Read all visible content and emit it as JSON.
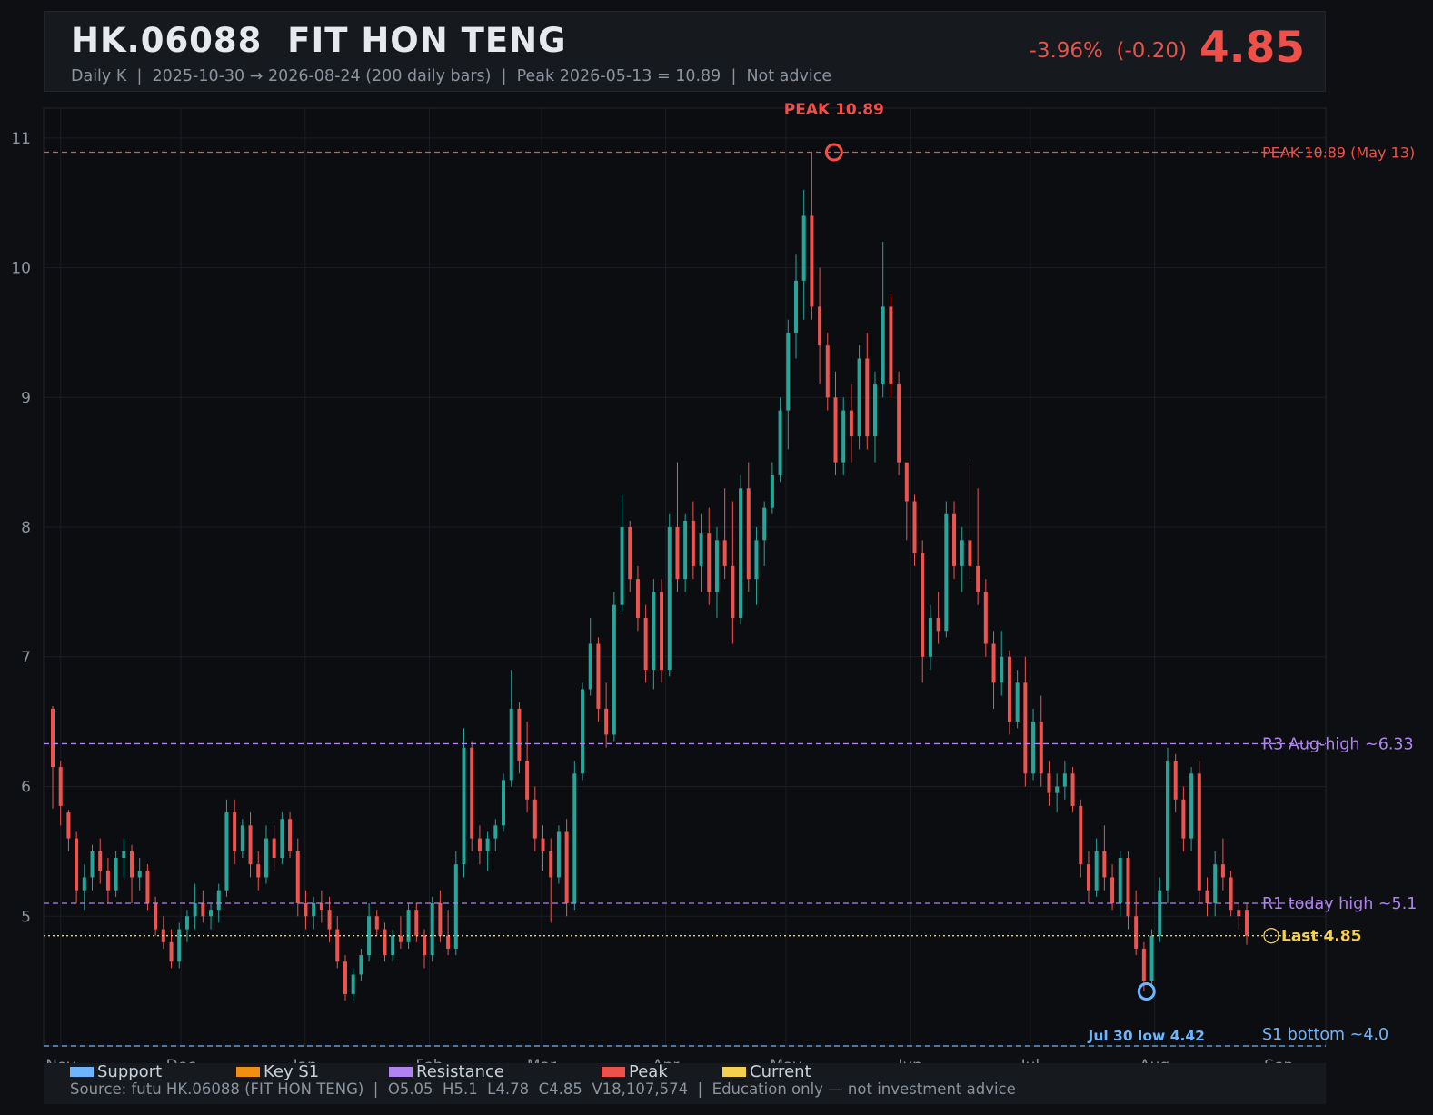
{
  "header": {
    "ticker": "HK.06088  FIT HON TENG",
    "subtitle": "Daily K  |  2025-10-30 → 2026-08-24 (200 daily bars)  |  Peak 2026-05-13 = 10.89  |  Not advice",
    "change": "-3.96%  (-0.20)",
    "price": "4.85"
  },
  "legend": [
    {
      "label": "Support",
      "color": "#6cb6ff"
    },
    {
      "label": "Key S1",
      "color": "#f0900e"
    },
    {
      "label": "Resistance",
      "color": "#b083f0"
    },
    {
      "label": "Peak",
      "color": "#f0504a"
    },
    {
      "label": "Current",
      "color": "#f5cf4e"
    }
  ],
  "source": "Source: futu HK.06088 (FIT HON TENG)  |  O5.05  H5.1  L4.78  C4.85  V18,107,574  |  Education only — not investment advice",
  "colors": {
    "up": "#26a69a",
    "down": "#ef5350",
    "peak": "#f0504a",
    "resistance": "#b083f0",
    "support": "#6cb6ff",
    "current": "#f5cf4e",
    "grid": "#1a1e23",
    "axis_text": "#8b949e"
  },
  "chart_data": {
    "type": "candlestick",
    "x_range": [
      "2025-10-30",
      "2026-08-24"
    ],
    "x_ticks": [
      "Nov",
      "Dec",
      "Jan",
      "Feb",
      "Mar",
      "Apr",
      "May",
      "Jun",
      "Jul",
      "Aug",
      "Sep"
    ],
    "x_tick_dates": [
      "2025-11-01",
      "2025-12-01",
      "2026-01-01",
      "2026-02-01",
      "2026-03-01",
      "2026-04-01",
      "2026-05-01",
      "2026-06-01",
      "2026-07-01",
      "2026-08-01",
      "2026-09-01"
    ],
    "y_ticks": [
      5,
      6,
      7,
      8,
      9,
      10,
      11
    ],
    "ylim": [
      4.0,
      11.23
    ],
    "grid": true,
    "bars": 200,
    "levels": [
      {
        "label": "PEAK 10.89 (May 13)",
        "value": 10.89,
        "role": "peak"
      },
      {
        "label": "R3 Aug-high ~6.33",
        "value": 6.33,
        "role": "resistance"
      },
      {
        "label": "R1 today high ~5.1",
        "value": 5.1,
        "role": "resistance"
      },
      {
        "label": "Last 4.85",
        "value": 4.85,
        "role": "current"
      },
      {
        "label": "S1 bottom ~4.0",
        "value": 4.0,
        "role": "support"
      }
    ],
    "annotations": [
      {
        "label": "PEAK 10.89",
        "date": "2026-05-13",
        "value": 10.89,
        "role": "peak"
      },
      {
        "label": "Jul 30 low 4.42",
        "date": "2026-07-30",
        "value": 4.42,
        "role": "support"
      }
    ],
    "ohlc": [
      [
        6.6,
        6.62,
        5.83,
        6.15
      ],
      [
        6.15,
        6.2,
        5.7,
        5.85
      ],
      [
        5.8,
        5.82,
        5.5,
        5.6
      ],
      [
        5.6,
        5.65,
        5.1,
        5.2
      ],
      [
        5.2,
        5.4,
        5.05,
        5.3
      ],
      [
        5.3,
        5.55,
        5.2,
        5.5
      ],
      [
        5.5,
        5.6,
        5.25,
        5.35
      ],
      [
        5.35,
        5.45,
        5.1,
        5.2
      ],
      [
        5.2,
        5.5,
        5.15,
        5.45
      ],
      [
        5.45,
        5.6,
        5.3,
        5.5
      ],
      [
        5.5,
        5.55,
        5.1,
        5.3
      ],
      [
        5.3,
        5.45,
        5.2,
        5.35
      ],
      [
        5.35,
        5.4,
        5.05,
        5.1
      ],
      [
        5.1,
        5.15,
        4.85,
        4.9
      ],
      [
        4.9,
        5.0,
        4.75,
        4.8
      ],
      [
        4.8,
        4.9,
        4.6,
        4.65
      ],
      [
        4.65,
        4.95,
        4.6,
        4.9
      ],
      [
        4.9,
        5.05,
        4.8,
        5.0
      ],
      [
        5.0,
        5.25,
        4.9,
        5.1
      ],
      [
        5.1,
        5.2,
        4.95,
        5.0
      ],
      [
        5.0,
        5.1,
        4.9,
        5.05
      ],
      [
        5.05,
        5.25,
        4.95,
        5.2
      ],
      [
        5.2,
        5.9,
        5.15,
        5.8
      ],
      [
        5.8,
        5.9,
        5.4,
        5.5
      ],
      [
        5.5,
        5.75,
        5.45,
        5.7
      ],
      [
        5.7,
        5.8,
        5.3,
        5.4
      ],
      [
        5.4,
        5.5,
        5.2,
        5.3
      ],
      [
        5.3,
        5.7,
        5.25,
        5.6
      ],
      [
        5.6,
        5.7,
        5.35,
        5.45
      ],
      [
        5.45,
        5.8,
        5.4,
        5.75
      ],
      [
        5.75,
        5.8,
        5.45,
        5.5
      ],
      [
        5.5,
        5.6,
        5.0,
        5.1
      ],
      [
        5.1,
        5.2,
        4.9,
        5.0
      ],
      [
        5.0,
        5.15,
        4.9,
        5.1
      ],
      [
        5.1,
        5.2,
        4.95,
        5.05
      ],
      [
        5.05,
        5.15,
        4.8,
        4.9
      ],
      [
        4.9,
        5.0,
        4.6,
        4.65
      ],
      [
        4.65,
        4.7,
        4.35,
        4.4
      ],
      [
        4.4,
        4.6,
        4.35,
        4.55
      ],
      [
        4.55,
        4.75,
        4.5,
        4.7
      ],
      [
        4.7,
        5.1,
        4.65,
        5.0
      ],
      [
        5.0,
        5.05,
        4.85,
        4.9
      ],
      [
        4.9,
        4.95,
        4.65,
        4.7
      ],
      [
        4.7,
        4.9,
        4.65,
        4.85
      ],
      [
        4.85,
        5.0,
        4.75,
        4.8
      ],
      [
        4.8,
        5.1,
        4.75,
        5.05
      ],
      [
        5.05,
        5.1,
        4.8,
        4.85
      ],
      [
        4.85,
        4.9,
        4.6,
        4.7
      ],
      [
        4.7,
        5.15,
        4.65,
        5.1
      ],
      [
        5.1,
        5.2,
        4.8,
        4.85
      ],
      [
        4.85,
        5.05,
        4.7,
        4.75
      ],
      [
        4.75,
        5.5,
        4.7,
        5.4
      ],
      [
        5.4,
        6.45,
        5.3,
        6.3
      ],
      [
        6.3,
        6.35,
        5.5,
        5.6
      ],
      [
        5.6,
        5.7,
        5.4,
        5.5
      ],
      [
        5.5,
        5.65,
        5.35,
        5.6
      ],
      [
        5.6,
        5.75,
        5.5,
        5.7
      ],
      [
        5.7,
        6.1,
        5.65,
        6.05
      ],
      [
        6.05,
        6.9,
        6.0,
        6.6
      ],
      [
        6.6,
        6.65,
        6.1,
        6.2
      ],
      [
        6.2,
        6.5,
        5.8,
        5.9
      ],
      [
        5.9,
        6.0,
        5.5,
        5.6
      ],
      [
        5.6,
        5.7,
        5.35,
        5.5
      ],
      [
        5.5,
        5.6,
        4.95,
        5.3
      ],
      [
        5.3,
        5.7,
        5.25,
        5.65
      ],
      [
        5.65,
        5.75,
        5.0,
        5.1
      ],
      [
        5.1,
        6.2,
        5.05,
        6.1
      ],
      [
        6.1,
        6.8,
        6.05,
        6.75
      ],
      [
        6.75,
        7.3,
        6.7,
        7.1
      ],
      [
        7.1,
        7.15,
        6.5,
        6.6
      ],
      [
        6.6,
        6.8,
        6.3,
        6.4
      ],
      [
        6.4,
        7.5,
        6.35,
        7.4
      ],
      [
        7.4,
        8.25,
        7.35,
        8.0
      ],
      [
        8.0,
        8.05,
        7.5,
        7.6
      ],
      [
        7.6,
        7.7,
        7.2,
        7.3
      ],
      [
        7.3,
        7.4,
        6.8,
        6.9
      ],
      [
        6.9,
        7.6,
        6.75,
        7.5
      ],
      [
        7.5,
        7.6,
        6.8,
        6.9
      ],
      [
        6.9,
        8.1,
        6.85,
        8.0
      ],
      [
        8.0,
        8.5,
        7.5,
        7.6
      ],
      [
        7.6,
        8.1,
        7.5,
        8.05
      ],
      [
        8.05,
        8.2,
        7.6,
        7.7
      ],
      [
        7.7,
        8.1,
        7.5,
        7.95
      ],
      [
        7.95,
        8.15,
        7.4,
        7.5
      ],
      [
        7.5,
        8.0,
        7.3,
        7.9
      ],
      [
        7.9,
        8.3,
        7.6,
        7.7
      ],
      [
        7.7,
        8.2,
        7.1,
        7.3
      ],
      [
        7.3,
        8.4,
        7.25,
        8.3
      ],
      [
        8.3,
        8.5,
        7.5,
        7.6
      ],
      [
        7.6,
        8.0,
        7.4,
        7.9
      ],
      [
        7.9,
        8.2,
        7.7,
        8.15
      ],
      [
        8.15,
        8.5,
        8.1,
        8.4
      ],
      [
        8.4,
        9.0,
        8.35,
        8.9
      ],
      [
        8.9,
        9.6,
        8.6,
        9.5
      ],
      [
        9.5,
        10.1,
        9.3,
        9.9
      ],
      [
        9.9,
        10.6,
        9.6,
        10.4
      ],
      [
        10.4,
        10.89,
        9.6,
        9.7
      ],
      [
        9.7,
        10.0,
        9.1,
        9.4
      ],
      [
        9.4,
        9.5,
        8.9,
        9.0
      ],
      [
        9.0,
        9.2,
        8.4,
        8.5
      ],
      [
        8.5,
        9.0,
        8.4,
        8.9
      ],
      [
        8.9,
        9.1,
        8.5,
        8.7
      ],
      [
        8.7,
        9.4,
        8.6,
        9.3
      ],
      [
        9.3,
        9.5,
        8.6,
        8.7
      ],
      [
        8.7,
        9.2,
        8.5,
        9.1
      ],
      [
        9.1,
        10.2,
        9.0,
        9.7
      ],
      [
        9.7,
        9.8,
        9.0,
        9.1
      ],
      [
        9.1,
        9.2,
        8.4,
        8.5
      ],
      [
        8.5,
        8.3,
        7.9,
        8.2
      ],
      [
        8.2,
        8.25,
        7.7,
        7.8
      ],
      [
        7.8,
        7.9,
        6.8,
        7.0
      ],
      [
        7.0,
        7.4,
        6.9,
        7.3
      ],
      [
        7.3,
        7.5,
        7.1,
        7.2
      ],
      [
        7.2,
        8.2,
        7.15,
        8.1
      ],
      [
        8.1,
        8.2,
        7.6,
        7.7
      ],
      [
        7.7,
        8.0,
        7.5,
        7.9
      ],
      [
        7.9,
        8.5,
        7.6,
        7.7
      ],
      [
        7.7,
        8.3,
        7.4,
        7.5
      ],
      [
        7.5,
        7.6,
        7.0,
        7.1
      ],
      [
        7.1,
        7.2,
        6.6,
        6.8
      ],
      [
        6.8,
        7.2,
        6.7,
        7.0
      ],
      [
        7.0,
        7.05,
        6.4,
        6.5
      ],
      [
        6.5,
        6.9,
        6.45,
        6.8
      ],
      [
        6.8,
        7.0,
        6.0,
        6.1
      ],
      [
        6.1,
        6.6,
        6.05,
        6.5
      ],
      [
        6.5,
        6.7,
        6.0,
        6.1
      ],
      [
        6.1,
        6.2,
        5.85,
        5.95
      ],
      [
        5.95,
        6.1,
        5.8,
        6.0
      ],
      [
        6.0,
        6.2,
        5.9,
        6.1
      ],
      [
        6.1,
        6.15,
        5.8,
        5.85
      ],
      [
        5.85,
        5.9,
        5.3,
        5.4
      ],
      [
        5.4,
        5.5,
        5.1,
        5.2
      ],
      [
        5.2,
        5.6,
        5.15,
        5.5
      ],
      [
        5.5,
        5.7,
        5.2,
        5.3
      ],
      [
        5.3,
        5.4,
        5.05,
        5.1
      ],
      [
        5.1,
        5.5,
        5.0,
        5.45
      ],
      [
        5.45,
        5.5,
        4.9,
        5.0
      ],
      [
        5.0,
        5.2,
        4.7,
        4.75
      ],
      [
        4.75,
        4.8,
        4.42,
        4.5
      ],
      [
        4.5,
        4.9,
        4.45,
        4.85
      ],
      [
        4.85,
        5.3,
        4.8,
        5.2
      ],
      [
        5.2,
        6.3,
        5.1,
        6.2
      ],
      [
        6.2,
        6.25,
        5.8,
        5.9
      ],
      [
        5.9,
        6.0,
        5.5,
        5.6
      ],
      [
        5.6,
        6.15,
        5.5,
        6.1
      ],
      [
        6.1,
        6.2,
        5.1,
        5.2
      ],
      [
        5.2,
        5.3,
        5.0,
        5.1
      ],
      [
        5.1,
        5.5,
        5.0,
        5.4
      ],
      [
        5.4,
        5.6,
        5.2,
        5.3
      ],
      [
        5.3,
        5.35,
        5.0,
        5.05
      ],
      [
        5.05,
        5.1,
        4.9,
        5.0
      ],
      [
        5.05,
        5.1,
        4.78,
        4.85
      ]
    ]
  }
}
